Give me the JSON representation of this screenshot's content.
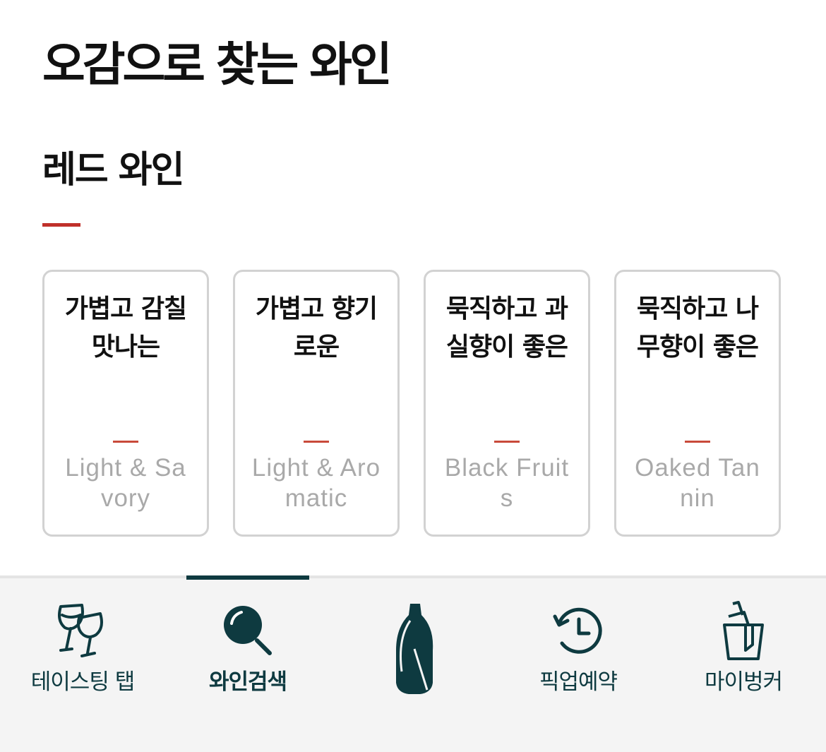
{
  "page": {
    "title": "오감으로 찾는 와인",
    "section_title": "레드 와인"
  },
  "cards": [
    {
      "ko": "가볍고 감칠맛나는",
      "en": "Light & Savory"
    },
    {
      "ko": "가볍고 향기로운",
      "en": "Light & Aromatic"
    },
    {
      "ko": "묵직하고 과실향이 좋은",
      "en": "Black Fruits"
    },
    {
      "ko": "묵직하고 나무향이 좋은",
      "en": "Oaked Tannin"
    }
  ],
  "bottom_nav": {
    "active_index": 1,
    "items": [
      {
        "label": "테이스팅 탭",
        "icon": "wine-glasses-icon"
      },
      {
        "label": "와인검색",
        "icon": "search-icon"
      },
      {
        "label": "",
        "icon": "wine-bottle-logo-icon"
      },
      {
        "label": "픽업예약",
        "icon": "history-clock-icon"
      },
      {
        "label": "마이벙커",
        "icon": "ice-bucket-icon"
      }
    ]
  },
  "colors": {
    "accent_red": "#c0302a",
    "nav_dark_teal": "#0e3a40",
    "card_border": "#d2d2d2",
    "english_text_gray": "#a9a9a9"
  }
}
